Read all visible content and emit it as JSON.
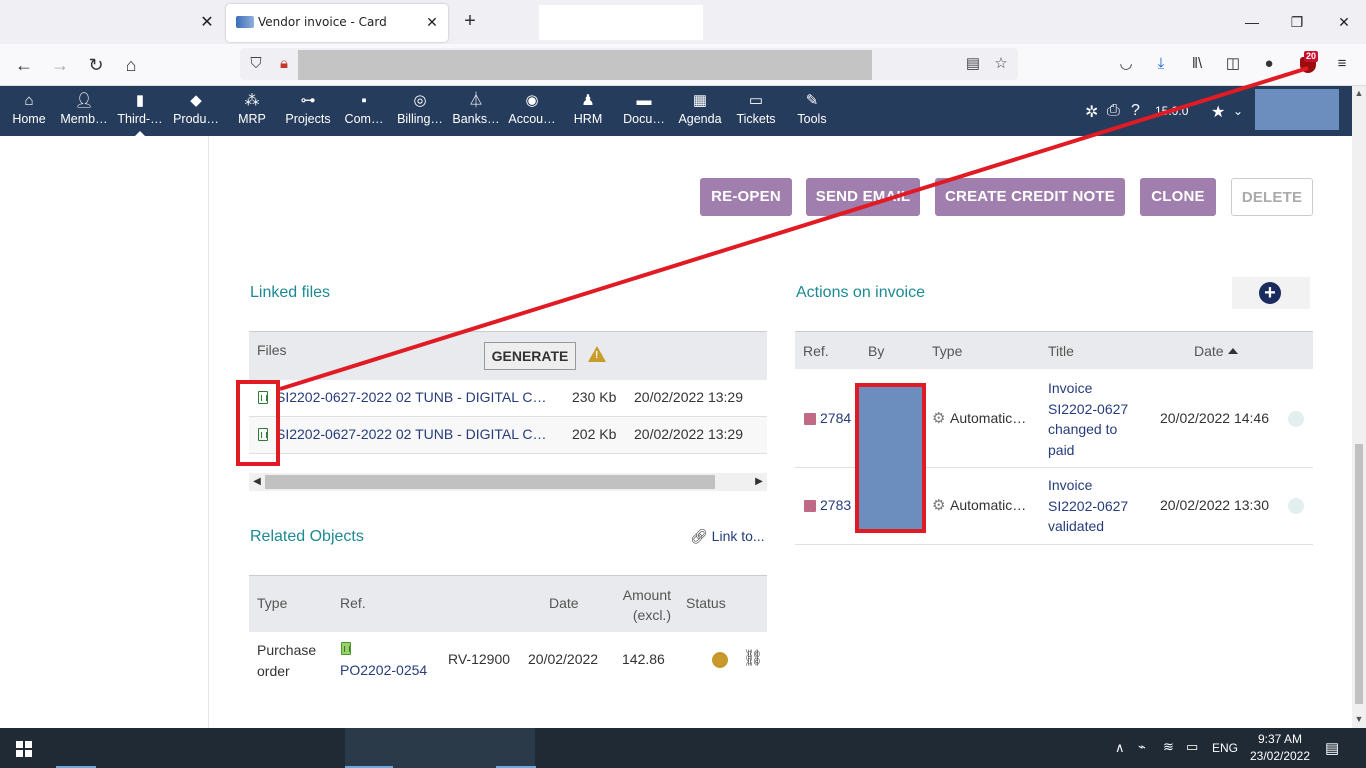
{
  "browser": {
    "tab_title": "Vendor invoice - Card",
    "tab_close": "✕",
    "new_tab": "+",
    "win_min": "—",
    "win_max": "❐",
    "win_close": "✕",
    "extension_badge": "20"
  },
  "menu": {
    "items": [
      {
        "label": "Home",
        "icon": "home-icon"
      },
      {
        "label": "Memb…",
        "icon": "member-icon"
      },
      {
        "label": "Third-…",
        "icon": "building-icon"
      },
      {
        "label": "Produ…",
        "icon": "box-icon"
      },
      {
        "label": "MRP",
        "icon": "cubes-icon"
      },
      {
        "label": "Projects",
        "icon": "sitemap-icon"
      },
      {
        "label": "Com…",
        "icon": "briefcase-icon"
      },
      {
        "label": "Billing…",
        "icon": "coins-icon"
      },
      {
        "label": "Banks…",
        "icon": "bank-icon"
      },
      {
        "label": "Accou…",
        "icon": "search-dollar-icon"
      },
      {
        "label": "HRM",
        "icon": "user-tie-icon"
      },
      {
        "label": "Docu…",
        "icon": "folder-icon"
      },
      {
        "label": "Agenda",
        "icon": "calendar-icon"
      },
      {
        "label": "Tickets",
        "icon": "ticket-icon"
      },
      {
        "label": "Tools",
        "icon": "wrench-icon"
      }
    ],
    "version": "15.0.0"
  },
  "actions": {
    "reopen": "RE-OPEN",
    "send_email": "SEND EMAIL",
    "credit_note": "CREATE CREDIT NOTE",
    "clone": "CLONE",
    "delete": "DELETE"
  },
  "linked_files": {
    "title": "Linked files",
    "header": "Files",
    "generate": "GENERATE",
    "rows": [
      {
        "name": "SI2202-0627-2022 02 TUNB - DIGITAL C…",
        "size": "230 Kb",
        "date": "20/02/2022 13:29"
      },
      {
        "name": "SI2202-0627-2022 02 TUNB - DIGITAL C…",
        "size": "202 Kb",
        "date": "20/02/2022 13:29"
      }
    ]
  },
  "related": {
    "title": "Related Objects",
    "link_to": "Link to...",
    "headers": {
      "type": "Type",
      "ref": "Ref.",
      "date": "Date",
      "amount": "Amount (excl.)",
      "status": "Status"
    },
    "rows": [
      {
        "type": "Purchase order",
        "ref": "PO2202-0254",
        "ref_supplier": "RV-12900",
        "date": "20/02/2022",
        "amount": "142.86"
      }
    ]
  },
  "events": {
    "title": "Actions on invoice",
    "headers": {
      "ref": "Ref.",
      "by": "By",
      "type": "Type",
      "title": "Title",
      "date": "Date"
    },
    "rows": [
      {
        "ref": "2784",
        "type": "Automatic…",
        "title": "Invoice SI2202-0627 changed to paid",
        "date": "20/02/2022 14:46"
      },
      {
        "ref": "2783",
        "type": "Automatic…",
        "title": "Invoice SI2202-0627 validated",
        "date": "20/02/2022 13:30"
      }
    ]
  },
  "taskbar": {
    "lang": "ENG",
    "time": "9:37 AM",
    "date": "23/02/2022"
  },
  "colors": {
    "menu_bg": "#263c5c",
    "button_bg": "#a07fae",
    "accent_teal": "#1d8a93",
    "annotation_red": "#e01b24",
    "redaction_blue": "#6c8ebf"
  }
}
